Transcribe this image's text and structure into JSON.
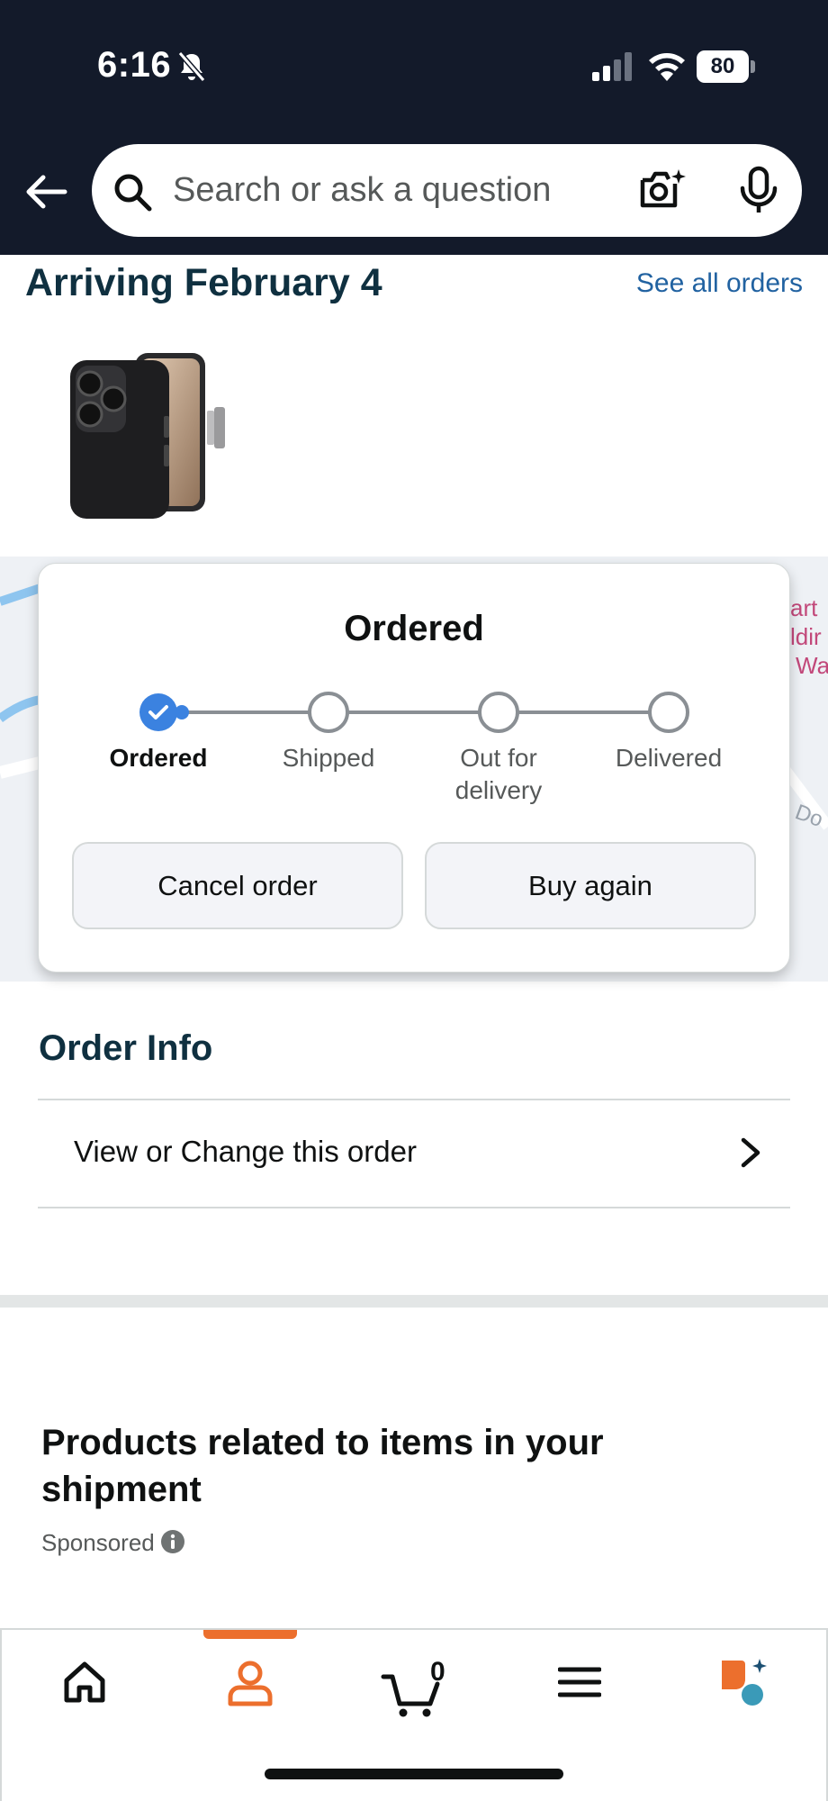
{
  "status_bar": {
    "time": "6:16",
    "battery": "80"
  },
  "search": {
    "placeholder": "Search or ask a question"
  },
  "arriving": {
    "title": "Arriving February 4",
    "see_all": "See all orders"
  },
  "tracker": {
    "title": "Ordered",
    "current_step": 0,
    "steps": [
      {
        "label": "Ordered"
      },
      {
        "label": "Shipped"
      },
      {
        "label": "Out for\ndelivery"
      },
      {
        "label": "Delivered"
      }
    ],
    "cancel_label": "Cancel order",
    "buy_again_label": "Buy again",
    "accent_color": "#3b82e0"
  },
  "order_info": {
    "title": "Order Info",
    "row_label": "View or Change this order"
  },
  "related": {
    "title": "Products related to items in your shipment",
    "sponsored": "Sponsored"
  },
  "bottom_nav": {
    "active_index": 1,
    "active_color": "#ec6f2d",
    "cart_count": "0",
    "items": [
      "home-icon",
      "account-icon",
      "cart-icon",
      "menu-icon",
      "rufus-ai-icon"
    ]
  }
}
